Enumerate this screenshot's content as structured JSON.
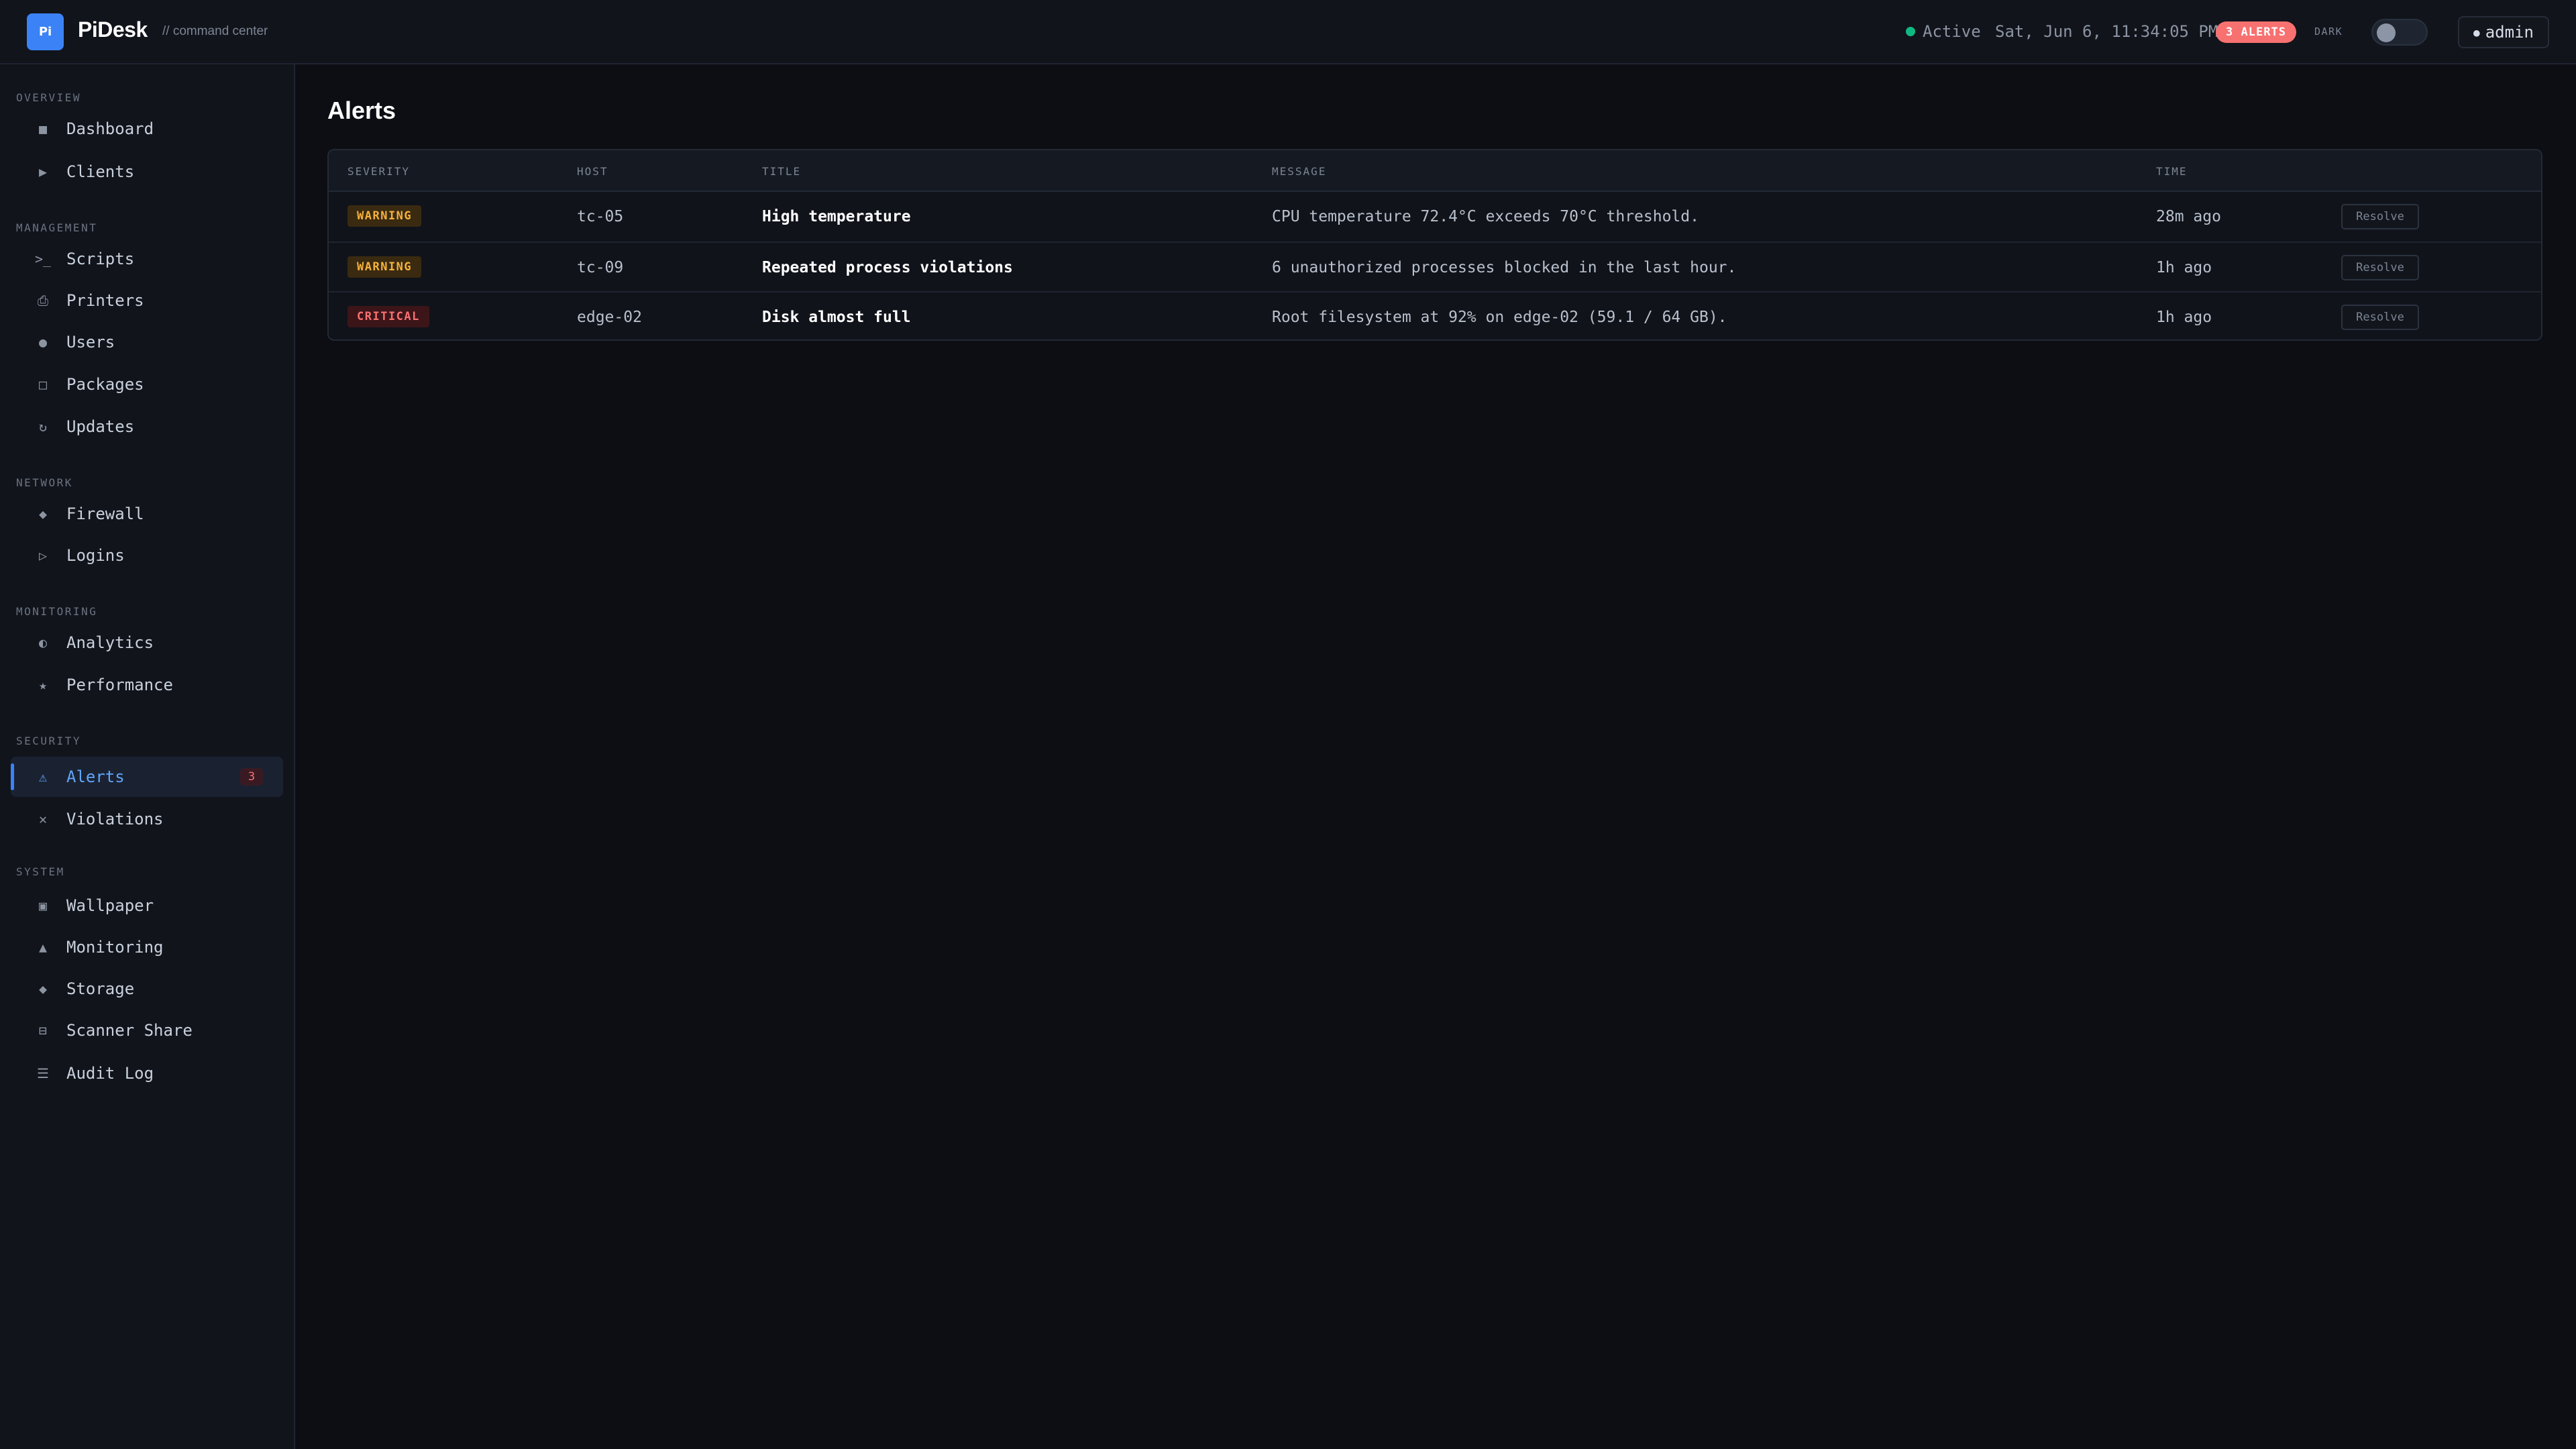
{
  "app": {
    "logo_text": "Pi",
    "name": "PiDesk",
    "subtitle": "// command center"
  },
  "topbar": {
    "status": "Active",
    "datetime": "Sat, Jun 6, 11:34:05 PM",
    "alerts_badge": "3 ALERTS",
    "theme_label": "DARK",
    "theme_dark": false,
    "user": "admin"
  },
  "colors": {
    "accent": "#3b82f6",
    "status_active": "#10b981",
    "alert": "#f87171",
    "warning": "#f5b13d"
  },
  "sidebar": {
    "sections": [
      {
        "label": "OVERVIEW",
        "items": [
          {
            "label": "Dashboard",
            "icon": "square-icon"
          },
          {
            "label": "Clients",
            "icon": "play-icon"
          }
        ]
      },
      {
        "label": "MANAGEMENT",
        "items": [
          {
            "label": "Scripts",
            "icon": "terminal-icon"
          },
          {
            "label": "Printers",
            "icon": "printer-icon"
          },
          {
            "label": "Users",
            "icon": "user-icon"
          },
          {
            "label": "Packages",
            "icon": "package-icon"
          },
          {
            "label": "Updates",
            "icon": "refresh-icon"
          }
        ]
      },
      {
        "label": "NETWORK",
        "items": [
          {
            "label": "Firewall",
            "icon": "diamond-icon"
          },
          {
            "label": "Logins",
            "icon": "triangle-right-icon"
          }
        ]
      },
      {
        "label": "MONITORING",
        "items": [
          {
            "label": "Analytics",
            "icon": "half-circle-icon"
          },
          {
            "label": "Performance",
            "icon": "star-icon"
          }
        ]
      },
      {
        "label": "SECURITY",
        "items": [
          {
            "label": "Alerts",
            "icon": "warning-icon",
            "badge": "3",
            "active": true
          },
          {
            "label": "Violations",
            "icon": "close-icon"
          }
        ]
      },
      {
        "label": "SYSTEM",
        "items": [
          {
            "label": "Wallpaper",
            "icon": "image-icon"
          },
          {
            "label": "Monitoring",
            "icon": "triangle-up-icon"
          },
          {
            "label": "Storage",
            "icon": "diamond-icon"
          },
          {
            "label": "Scanner Share",
            "icon": "scanner-icon"
          },
          {
            "label": "Audit Log",
            "icon": "list-icon"
          }
        ]
      }
    ]
  },
  "main": {
    "title": "Alerts",
    "table": {
      "columns": [
        "SEVERITY",
        "HOST",
        "TITLE",
        "MESSAGE",
        "TIME"
      ],
      "rows": [
        {
          "severity": "WARNING",
          "host": "tc-05",
          "title": "High temperature",
          "message": "CPU temperature 72.4°C exceeds 70°C threshold.",
          "time": "28m ago",
          "action": "Resolve"
        },
        {
          "severity": "WARNING",
          "host": "tc-09",
          "title": "Repeated process violations",
          "message": "6 unauthorized processes blocked in the last hour.",
          "time": "1h ago",
          "action": "Resolve"
        },
        {
          "severity": "CRITICAL",
          "host": "edge-02",
          "title": "Disk almost full",
          "message": "Root filesystem at 92% on edge-02 (59.1 / 64 GB).",
          "time": "1h ago",
          "action": "Resolve"
        }
      ]
    }
  }
}
